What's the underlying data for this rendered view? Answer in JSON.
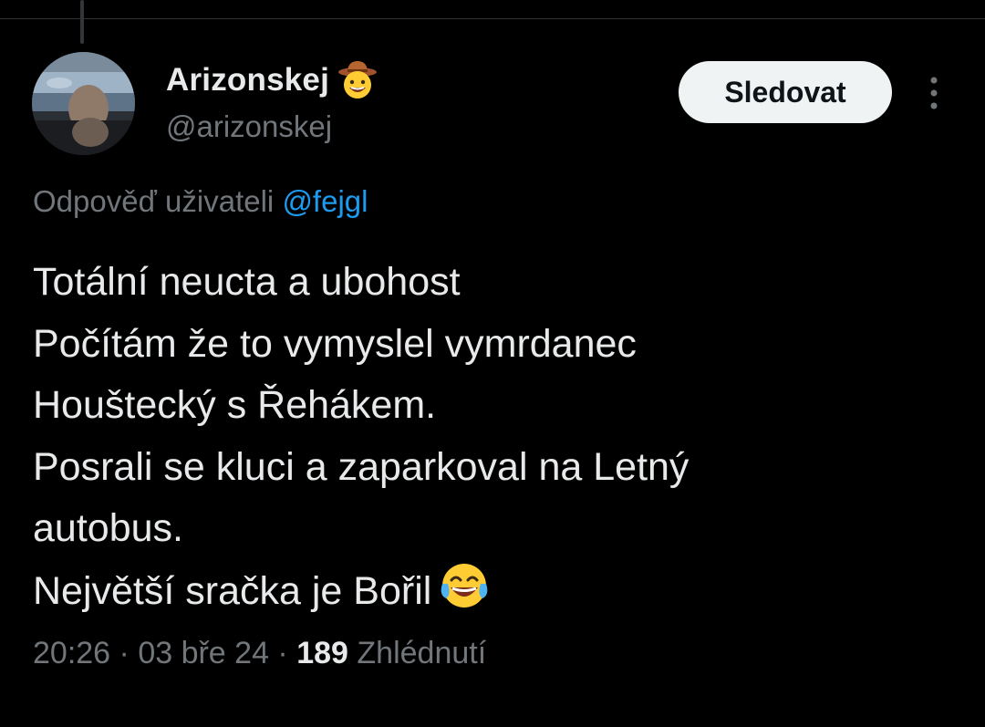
{
  "tweet": {
    "author": {
      "display_name": "Arizonskej",
      "name_emoji": "cowboy-hat-face-emoji",
      "handle": "@arizonskej",
      "avatar": "profile-photo"
    },
    "follow_label": "Sledovat",
    "more_icon": "more-vertical-icon",
    "reply_to": {
      "prefix": "Odpověď uživateli",
      "mention": "@fejgl"
    },
    "text_lines": [
      "Totální neucta a ubohost",
      "Počítám že to vymyslel vymrdanec",
      "Houštecký s Řehákem.",
      "Posrali se kluci a zaparkoval na Letný",
      "autobus.",
      "Největší sračka je Bořil"
    ],
    "text_end_emoji": "face-with-tears-of-joy-emoji",
    "meta": {
      "time": "20:26",
      "separator": " · ",
      "date": "03 bře 24",
      "views_count": "189",
      "views_label": "Zhlédnutí"
    }
  },
  "colors": {
    "background": "#000000",
    "text_primary": "#e7e9ea",
    "text_secondary": "#71767b",
    "link": "#1d9bf0",
    "follow_button_bg": "#eff3f4",
    "follow_button_text": "#0f1419",
    "divider": "#2f3336"
  }
}
